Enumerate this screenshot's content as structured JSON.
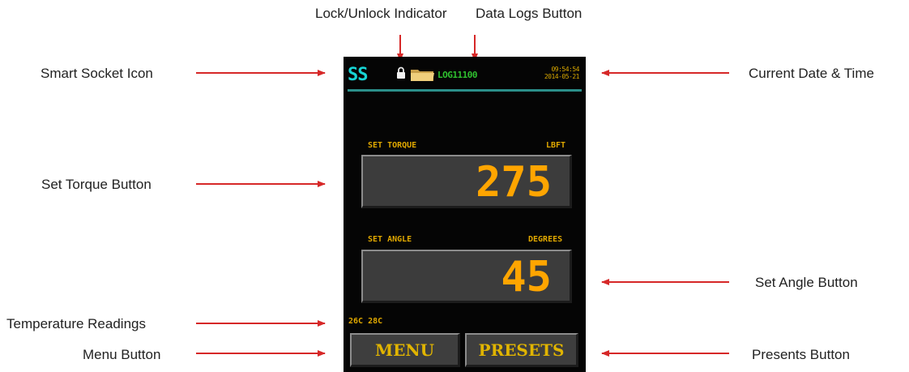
{
  "callouts": {
    "lock_indicator": "Lock/Unlock Indicator",
    "data_logs_button": "Data Logs Button",
    "smart_socket_icon": "Smart Socket Icon",
    "current_date_time": "Current Date & Time",
    "set_torque_button": "Set Torque Button",
    "set_angle_button": "Set Angle Button",
    "temperature_readings": "Temperature Readings",
    "menu_button": "Menu Button",
    "presents_button": "Presents Button"
  },
  "screen": {
    "app_icon_text": "SS",
    "lock_icon": "padlock-icon",
    "folder_icon": "folder-icon",
    "log_label": "LOG11100",
    "time": "09:54:54",
    "date": "2014-05-21",
    "torque": {
      "label": "SET TORQUE",
      "unit": "LBFT",
      "value": "275"
    },
    "angle": {
      "label": "SET ANGLE",
      "unit": "DEGREES",
      "value": "45"
    },
    "temperatures": "26C 28C",
    "menu_label": "MENU",
    "presets_label": "PRESETS"
  },
  "colors": {
    "callout_arrow": "#d62828",
    "screen_background": "#050505",
    "socket_icon": "#17d4d4",
    "log_text": "#2fc12f",
    "value_text": "#ffa500",
    "label_text": "#e0a800",
    "button_face": "#3c3c3c",
    "header_rule": "#2b8f8a"
  }
}
